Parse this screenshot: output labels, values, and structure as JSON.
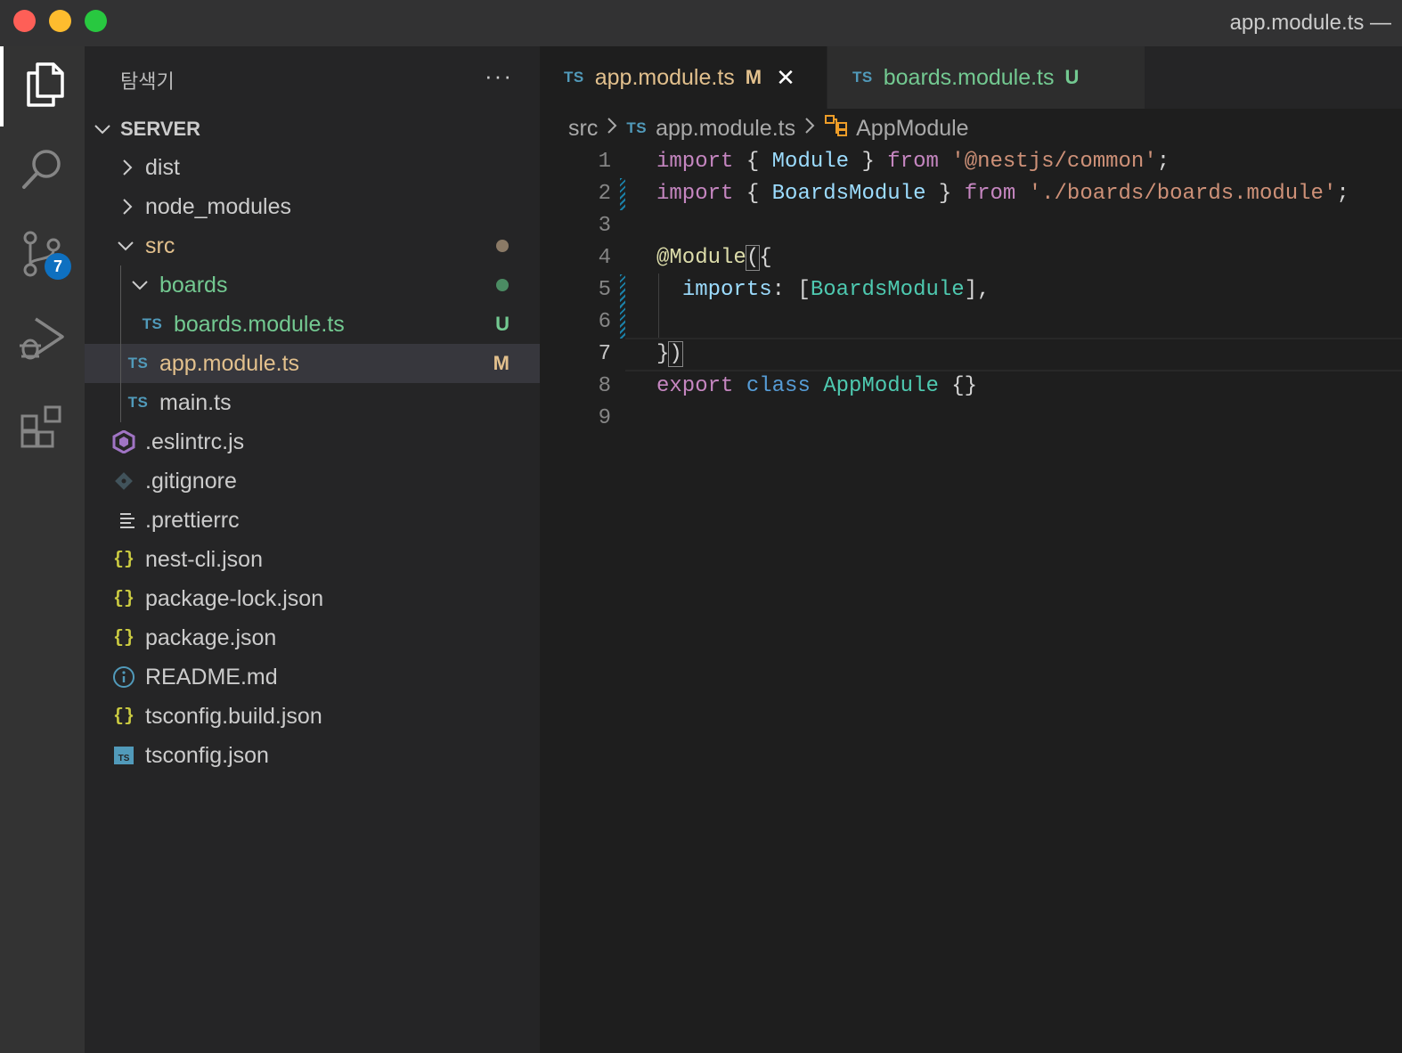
{
  "window": {
    "title": "app.module.ts —"
  },
  "activity_bar": {
    "items": [
      "files-icon",
      "search-icon",
      "source-control-icon",
      "run-debug-icon",
      "extensions-icon"
    ],
    "source_control_badge": "7"
  },
  "sidebar": {
    "header": "탐색기",
    "more": "···",
    "section": "SERVER",
    "tree": [
      {
        "label": "dist",
        "type": "folder",
        "expanded": false
      },
      {
        "label": "node_modules",
        "type": "folder",
        "expanded": false
      },
      {
        "label": "src",
        "type": "folder",
        "expanded": true,
        "color": "#e2c08d",
        "status_dot": "#8b7a66"
      },
      {
        "label": "boards",
        "type": "folder",
        "expanded": true,
        "color": "#73c991",
        "status_dot": "#4b8c63"
      },
      {
        "label": "boards.module.ts",
        "type": "ts",
        "status": "U",
        "color": "#73c991"
      },
      {
        "label": "app.module.ts",
        "type": "ts",
        "status": "M",
        "color": "#e2c08d",
        "selected": true
      },
      {
        "label": "main.ts",
        "type": "ts"
      },
      {
        "label": ".eslintrc.js",
        "type": "eslint"
      },
      {
        "label": ".gitignore",
        "type": "git"
      },
      {
        "label": ".prettierrc",
        "type": "text"
      },
      {
        "label": "nest-cli.json",
        "type": "json"
      },
      {
        "label": "package-lock.json",
        "type": "json"
      },
      {
        "label": "package.json",
        "type": "json"
      },
      {
        "label": "README.md",
        "type": "info"
      },
      {
        "label": "tsconfig.build.json",
        "type": "json"
      },
      {
        "label": "tsconfig.json",
        "type": "tsconfig"
      }
    ]
  },
  "editor": {
    "tabs": [
      {
        "icon": "TS",
        "label": "app.module.ts",
        "status": "M",
        "close": "✕",
        "active": true
      },
      {
        "icon": "TS",
        "label": "boards.module.ts",
        "status": "U",
        "active": false
      }
    ],
    "breadcrumb": {
      "folder": "src",
      "icon": "TS",
      "file": "app.module.ts",
      "symbol": "AppModule"
    },
    "line_numbers": [
      "1",
      "2",
      "3",
      "4",
      "5",
      "6",
      "7",
      "8",
      "9"
    ],
    "current_line": "7",
    "code_lines": [
      "import { Module } from '@nestjs/common';",
      "import { BoardsModule } from './boards/boards.module';",
      "",
      "@Module({",
      "  imports: [BoardsModule],",
      "",
      "})",
      "export class AppModule {}",
      ""
    ]
  }
}
